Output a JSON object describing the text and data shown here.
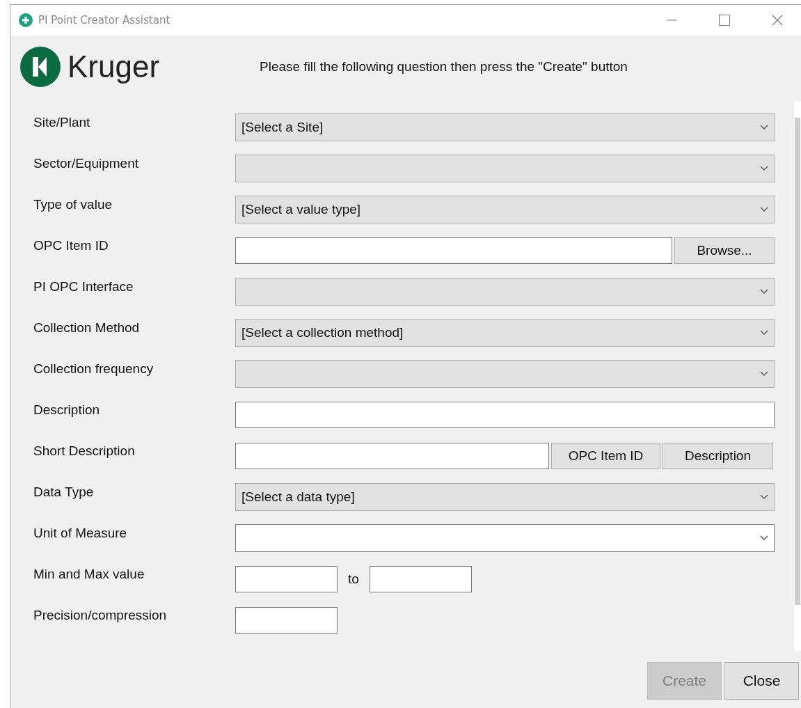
{
  "window": {
    "title": "PI Point Creator Assistant"
  },
  "logo": {
    "text": "Kruger"
  },
  "instruction": "Please fill the following question then press the \"Create\" button",
  "fields": [
    {
      "label": "Site/Plant",
      "kind": "select",
      "value": "[Select a Site]",
      "editable": false
    },
    {
      "label": "Sector/Equipment",
      "kind": "select",
      "editable": false
    },
    {
      "label": "Type of value",
      "kind": "select",
      "value": "[Select a value type]",
      "editable": false
    },
    {
      "label": "OPC Item ID",
      "kind": "browse",
      "button": "Browse..."
    },
    {
      "label": "PI OPC Interface",
      "kind": "select",
      "editable": false
    },
    {
      "label": "Collection Method",
      "kind": "select",
      "value": "[Select a collection method]",
      "editable": false
    },
    {
      "label": "Collection frequency",
      "kind": "select",
      "editable": false
    },
    {
      "label": "Description",
      "kind": "text"
    },
    {
      "label": "Short Description",
      "kind": "fill",
      "buttons": [
        "OPC Item ID",
        "Description"
      ]
    },
    {
      "label": "Data Type",
      "kind": "select",
      "value": "[Select a data type]",
      "editable": false
    },
    {
      "label": "Unit of Measure",
      "kind": "select",
      "editable": true
    },
    {
      "label": "Min and Max value",
      "kind": "range",
      "separator": "to"
    },
    {
      "label": "Precision/compression",
      "kind": "small"
    }
  ],
  "buttons": [
    {
      "label": "Create",
      "disabled": true
    },
    {
      "label": "Close",
      "disabled": false
    }
  ]
}
